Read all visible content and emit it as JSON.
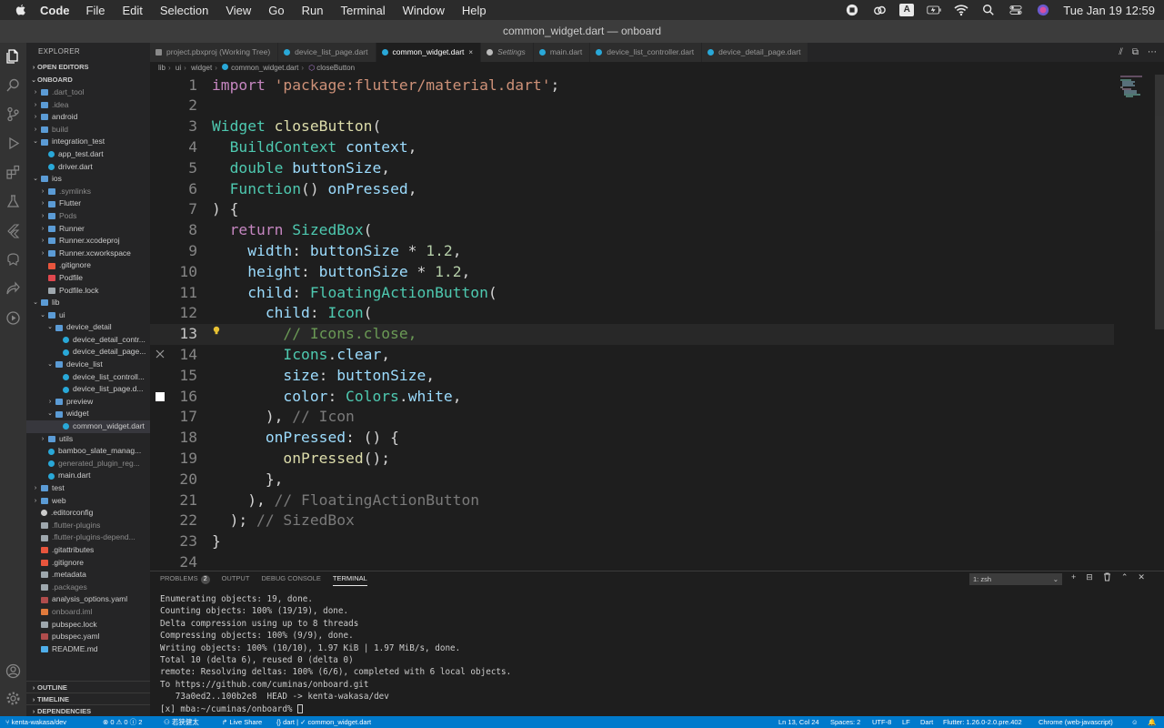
{
  "menubar": {
    "app": "Code",
    "items": [
      "File",
      "Edit",
      "Selection",
      "View",
      "Go",
      "Run",
      "Terminal",
      "Window",
      "Help"
    ],
    "status_input": "A",
    "clock": "Tue Jan 19  12:59"
  },
  "window": {
    "title": "common_widget.dart — onboard"
  },
  "sidebar": {
    "title": "EXPLORER",
    "open_editors": "OPEN EDITORS",
    "project": "ONBOARD",
    "tree": [
      {
        "label": ".dart_tool",
        "depth": 1,
        "kind": "folder",
        "chev": "›",
        "dim": true
      },
      {
        "label": ".idea",
        "depth": 1,
        "kind": "folder",
        "chev": "›",
        "dim": true
      },
      {
        "label": "android",
        "depth": 1,
        "kind": "folder",
        "chev": "›"
      },
      {
        "label": "build",
        "depth": 1,
        "kind": "folder",
        "chev": "›",
        "dim": true
      },
      {
        "label": "integration_test",
        "depth": 1,
        "kind": "folder",
        "chev": "⌄"
      },
      {
        "label": "app_test.dart",
        "depth": 2,
        "kind": "dart"
      },
      {
        "label": "driver.dart",
        "depth": 2,
        "kind": "dart"
      },
      {
        "label": "ios",
        "depth": 1,
        "kind": "folder",
        "chev": "⌄"
      },
      {
        "label": ".symlinks",
        "depth": 2,
        "kind": "folder",
        "chev": "›",
        "dim": true
      },
      {
        "label": "Flutter",
        "depth": 2,
        "kind": "folder",
        "chev": "›"
      },
      {
        "label": "Pods",
        "depth": 2,
        "kind": "folder",
        "chev": "›",
        "dim": true
      },
      {
        "label": "Runner",
        "depth": 2,
        "kind": "folder",
        "chev": "›"
      },
      {
        "label": "Runner.xcodeproj",
        "depth": 2,
        "kind": "folder",
        "chev": "›"
      },
      {
        "label": "Runner.xcworkspace",
        "depth": 2,
        "kind": "folder",
        "chev": "›"
      },
      {
        "label": ".gitignore",
        "depth": 2,
        "kind": "git"
      },
      {
        "label": "Podfile",
        "depth": 2,
        "kind": "rb"
      },
      {
        "label": "Podfile.lock",
        "depth": 2,
        "kind": "file"
      },
      {
        "label": "lib",
        "depth": 1,
        "kind": "folder",
        "chev": "⌄"
      },
      {
        "label": "ui",
        "depth": 2,
        "kind": "folder",
        "chev": "⌄"
      },
      {
        "label": "device_detail",
        "depth": 3,
        "kind": "folder",
        "chev": "⌄"
      },
      {
        "label": "device_detail_contr...",
        "depth": 4,
        "kind": "dart"
      },
      {
        "label": "device_detail_page...",
        "depth": 4,
        "kind": "dart"
      },
      {
        "label": "device_list",
        "depth": 3,
        "kind": "folder",
        "chev": "⌄"
      },
      {
        "label": "device_list_controll...",
        "depth": 4,
        "kind": "dart"
      },
      {
        "label": "device_list_page.d...",
        "depth": 4,
        "kind": "dart"
      },
      {
        "label": "preview",
        "depth": 3,
        "kind": "folder",
        "chev": "›"
      },
      {
        "label": "widget",
        "depth": 3,
        "kind": "folder",
        "chev": "⌄"
      },
      {
        "label": "common_widget.dart",
        "depth": 4,
        "kind": "dart",
        "selected": true
      },
      {
        "label": "utils",
        "depth": 2,
        "kind": "folder",
        "chev": "›"
      },
      {
        "label": "bamboo_slate_manag...",
        "depth": 2,
        "kind": "dart"
      },
      {
        "label": "generated_plugin_reg...",
        "depth": 2,
        "kind": "dart",
        "dim": true
      },
      {
        "label": "main.dart",
        "depth": 2,
        "kind": "dart"
      },
      {
        "label": "test",
        "depth": 1,
        "kind": "folder",
        "chev": "›"
      },
      {
        "label": "web",
        "depth": 1,
        "kind": "folder",
        "chev": "›"
      },
      {
        "label": ".editorconfig",
        "depth": 1,
        "kind": "gear"
      },
      {
        "label": ".flutter-plugins",
        "depth": 1,
        "kind": "file",
        "dim": true
      },
      {
        "label": ".flutter-plugins-depend...",
        "depth": 1,
        "kind": "file",
        "dim": true
      },
      {
        "label": ".gitattributes",
        "depth": 1,
        "kind": "git"
      },
      {
        "label": ".gitignore",
        "depth": 1,
        "kind": "git"
      },
      {
        "label": ".metadata",
        "depth": 1,
        "kind": "file"
      },
      {
        "label": ".packages",
        "depth": 1,
        "kind": "file",
        "dim": true
      },
      {
        "label": "analysis_options.yaml",
        "depth": 1,
        "kind": "yaml"
      },
      {
        "label": "onboard.iml",
        "depth": 1,
        "kind": "orange",
        "dim": true
      },
      {
        "label": "pubspec.lock",
        "depth": 1,
        "kind": "file"
      },
      {
        "label": "pubspec.yaml",
        "depth": 1,
        "kind": "yaml"
      },
      {
        "label": "README.md",
        "depth": 1,
        "kind": "info"
      }
    ],
    "outline": "OUTLINE",
    "timeline": "TIMELINE",
    "dependencies": "DEPENDENCIES"
  },
  "tabs": [
    {
      "label": "project.pbxproj (Working Tree)",
      "icon": "plain"
    },
    {
      "label": "device_list_page.dart",
      "icon": "dart"
    },
    {
      "label": "common_widget.dart",
      "icon": "dart",
      "active": true,
      "close": "×"
    },
    {
      "label": "Settings",
      "icon": "gear",
      "italic": true
    },
    {
      "label": "main.dart",
      "icon": "dart"
    },
    {
      "label": "device_list_controller.dart",
      "icon": "dart"
    },
    {
      "label": "device_detail_page.dart",
      "icon": "dart"
    }
  ],
  "tab_actions": [
    "⫽",
    "⧉",
    "⋯"
  ],
  "breadcrumb": [
    "lib",
    "ui",
    "widget",
    "common_widget.dart",
    "closeButton"
  ],
  "editor": {
    "current_line": 13,
    "lines": [
      [
        [
          "kw-imp",
          "import "
        ],
        [
          "str",
          "'package:flutter/material.dart'"
        ],
        [
          "plain",
          ";"
        ]
      ],
      [],
      [
        [
          "type",
          "Widget "
        ],
        [
          "fn",
          "closeButton"
        ],
        [
          "plain",
          "("
        ]
      ],
      [
        [
          "plain",
          "  "
        ],
        [
          "type",
          "BuildContext "
        ],
        [
          "var",
          "context"
        ],
        [
          "plain",
          ","
        ]
      ],
      [
        [
          "plain",
          "  "
        ],
        [
          "type",
          "double "
        ],
        [
          "var",
          "buttonSize"
        ],
        [
          "plain",
          ","
        ]
      ],
      [
        [
          "plain",
          "  "
        ],
        [
          "type",
          "Function"
        ],
        [
          "plain",
          "() "
        ],
        [
          "var",
          "onPressed"
        ],
        [
          "plain",
          ","
        ]
      ],
      [
        [
          "plain",
          ") {"
        ]
      ],
      [
        [
          "plain",
          "  "
        ],
        [
          "kw-imp",
          "return "
        ],
        [
          "type",
          "SizedBox"
        ],
        [
          "plain",
          "("
        ]
      ],
      [
        [
          "plain",
          "    "
        ],
        [
          "var",
          "width"
        ],
        [
          "plain",
          ": "
        ],
        [
          "var",
          "buttonSize"
        ],
        [
          "plain",
          " * "
        ],
        [
          "num",
          "1.2"
        ],
        [
          "plain",
          ","
        ]
      ],
      [
        [
          "plain",
          "    "
        ],
        [
          "var",
          "height"
        ],
        [
          "plain",
          ": "
        ],
        [
          "var",
          "buttonSize"
        ],
        [
          "plain",
          " * "
        ],
        [
          "num",
          "1.2"
        ],
        [
          "plain",
          ","
        ]
      ],
      [
        [
          "plain",
          "    "
        ],
        [
          "var",
          "child"
        ],
        [
          "plain",
          ": "
        ],
        [
          "type",
          "FloatingActionButton"
        ],
        [
          "plain",
          "("
        ]
      ],
      [
        [
          "plain",
          "      "
        ],
        [
          "var",
          "child"
        ],
        [
          "plain",
          ": "
        ],
        [
          "type",
          "Icon"
        ],
        [
          "plain",
          "("
        ]
      ],
      [
        [
          "plain",
          "        "
        ],
        [
          "cmt",
          "// Icons.close,"
        ]
      ],
      [
        [
          "plain",
          "        "
        ],
        [
          "type",
          "Icons"
        ],
        [
          "plain",
          "."
        ],
        [
          "var",
          "clear"
        ],
        [
          "plain",
          ","
        ]
      ],
      [
        [
          "plain",
          "        "
        ],
        [
          "var",
          "size"
        ],
        [
          "plain",
          ": "
        ],
        [
          "var",
          "buttonSize"
        ],
        [
          "plain",
          ","
        ]
      ],
      [
        [
          "plain",
          "        "
        ],
        [
          "var",
          "color"
        ],
        [
          "plain",
          ": "
        ],
        [
          "type",
          "Colors"
        ],
        [
          "plain",
          "."
        ],
        [
          "var",
          "white"
        ],
        [
          "plain",
          ","
        ]
      ],
      [
        [
          "plain",
          "      ), "
        ],
        [
          "hint",
          "// Icon"
        ]
      ],
      [
        [
          "plain",
          "      "
        ],
        [
          "var",
          "onPressed"
        ],
        [
          "plain",
          ": () {"
        ]
      ],
      [
        [
          "plain",
          "        "
        ],
        [
          "fn",
          "onPressed"
        ],
        [
          "plain",
          "();"
        ]
      ],
      [
        [
          "plain",
          "      },"
        ]
      ],
      [
        [
          "plain",
          "    ), "
        ],
        [
          "hint",
          "// FloatingActionButton"
        ]
      ],
      [
        [
          "plain",
          "  ); "
        ],
        [
          "hint",
          "// SizedBox"
        ]
      ],
      [
        [
          "plain",
          "}"
        ]
      ],
      []
    ]
  },
  "panel": {
    "tabs": [
      {
        "label": "PROBLEMS",
        "badge": "2"
      },
      {
        "label": "OUTPUT"
      },
      {
        "label": "DEBUG CONSOLE"
      },
      {
        "label": "TERMINAL",
        "active": true
      }
    ],
    "terminal_select": "1: zsh",
    "actions": [
      "+",
      "⊟",
      "🗑",
      "⌃",
      "✕"
    ],
    "terminal_lines": [
      "Enumerating objects: 19, done.",
      "Counting objects: 100% (19/19), done.",
      "Delta compression using up to 8 threads",
      "Compressing objects: 100% (9/9), done.",
      "Writing objects: 100% (10/10), 1.97 KiB | 1.97 MiB/s, done.",
      "Total 10 (delta 6), reused 0 (delta 0)",
      "remote: Resolving deltas: 100% (6/6), completed with 6 local objects.",
      "To https://github.com/cuminas/onboard.git",
      "   73a0ed2..100b2e8  HEAD -> kenta-wakasa/dev"
    ],
    "prompt": "[x] mba:~/cuminas/onboard% "
  },
  "statusbar": {
    "branch": "kenta-wakasa/dev",
    "problems": "⊗ 0 ⚠ 0 ⓘ 2",
    "user": "若狭健太",
    "live_share": "Live Share",
    "dart_file": "dart | ✓ common_widget.dart",
    "position": "Ln 13, Col 24",
    "spaces": "Spaces: 2",
    "encoding": "UTF-8",
    "eol": "LF",
    "lang": "Dart",
    "flutter": "Flutter: 1.26.0-2.0.pre.402",
    "device": "Chrome (web-javascript)"
  },
  "colors": {
    "statusbar": "#007acc",
    "accent": "#0e639c"
  }
}
